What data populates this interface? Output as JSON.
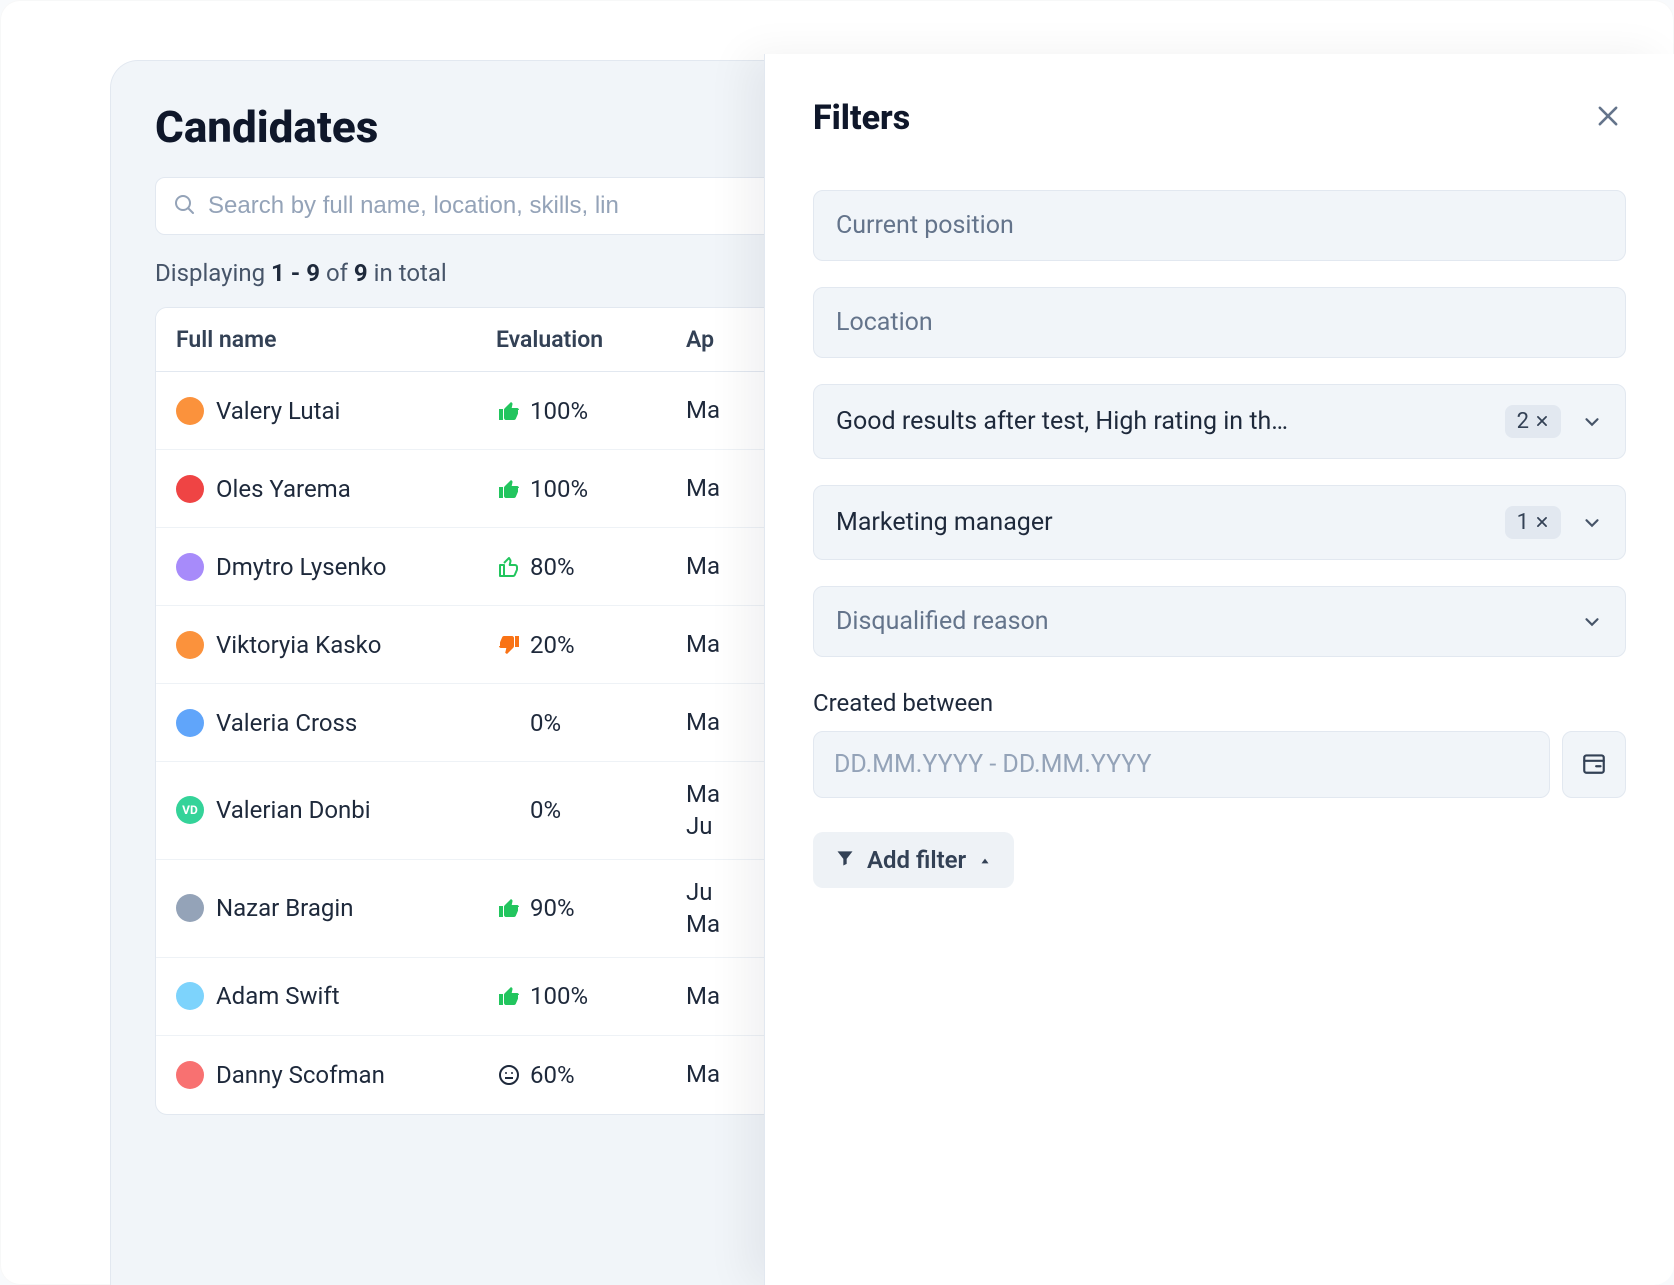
{
  "page_title": "Candidates",
  "search_placeholder": "Search by full name, location, skills, lin",
  "displaying": {
    "prefix": "Displaying ",
    "range": "1 - 9",
    "mid": " of ",
    "total": "9",
    "suffix": " in total"
  },
  "table": {
    "columns": {
      "name": "Full name",
      "evaluation": "Evaluation",
      "ap": "Ap"
    },
    "rows": [
      {
        "name": "Valery Lutai",
        "avatar_bg": "#fb923c",
        "avatar_text": "",
        "eval_kind": "up-solid",
        "eval_text": "100%",
        "ap": [
          "Ma"
        ]
      },
      {
        "name": "Oles Yarema",
        "avatar_bg": "#ef4444",
        "avatar_text": "",
        "eval_kind": "up-solid",
        "eval_text": "100%",
        "ap": [
          "Ma"
        ]
      },
      {
        "name": "Dmytro Lysenko",
        "avatar_bg": "#a78bfa",
        "avatar_text": "",
        "eval_kind": "up-outline",
        "eval_text": "80%",
        "ap": [
          "Ma"
        ]
      },
      {
        "name": "Viktoryia Kasko",
        "avatar_bg": "#fb923c",
        "avatar_text": "",
        "eval_kind": "down-solid",
        "eval_text": "20%",
        "ap": [
          "Ma"
        ]
      },
      {
        "name": "Valeria Cross",
        "avatar_bg": "#60a5fa",
        "avatar_text": "",
        "eval_kind": "none",
        "eval_text": "0%",
        "ap": [
          "Ma"
        ]
      },
      {
        "name": "Valerian Donbi",
        "avatar_bg": "#34d399",
        "avatar_text": "VD",
        "eval_kind": "none",
        "eval_text": "0%",
        "ap": [
          "Ma",
          "Ju"
        ]
      },
      {
        "name": "Nazar Bragin",
        "avatar_bg": "#94a3b8",
        "avatar_text": "",
        "eval_kind": "up-solid",
        "eval_text": "90%",
        "ap": [
          "Ju",
          "Ma"
        ]
      },
      {
        "name": "Adam Swift",
        "avatar_bg": "#7dd3fc",
        "avatar_text": "",
        "eval_kind": "up-solid",
        "eval_text": "100%",
        "ap": [
          "Ma"
        ]
      },
      {
        "name": "Danny Scofman",
        "avatar_bg": "#f87171",
        "avatar_text": "",
        "eval_kind": "neutral",
        "eval_text": "60%",
        "ap": [
          "Ma"
        ]
      }
    ]
  },
  "filters": {
    "title": "Filters",
    "fields": [
      {
        "kind": "placeholder",
        "label": "Current position"
      },
      {
        "kind": "placeholder",
        "label": "Location"
      },
      {
        "kind": "selected",
        "label": "Good results after test, High rating in th…",
        "count": "2"
      },
      {
        "kind": "selected",
        "label": "Marketing manager",
        "count": "1"
      },
      {
        "kind": "placeholder-dropdown",
        "label": "Disqualified reason"
      }
    ],
    "date_label": "Created between",
    "date_placeholder": "DD.MM.YYYY - DD.MM.YYYY",
    "add_filter_label": "Add filter"
  }
}
